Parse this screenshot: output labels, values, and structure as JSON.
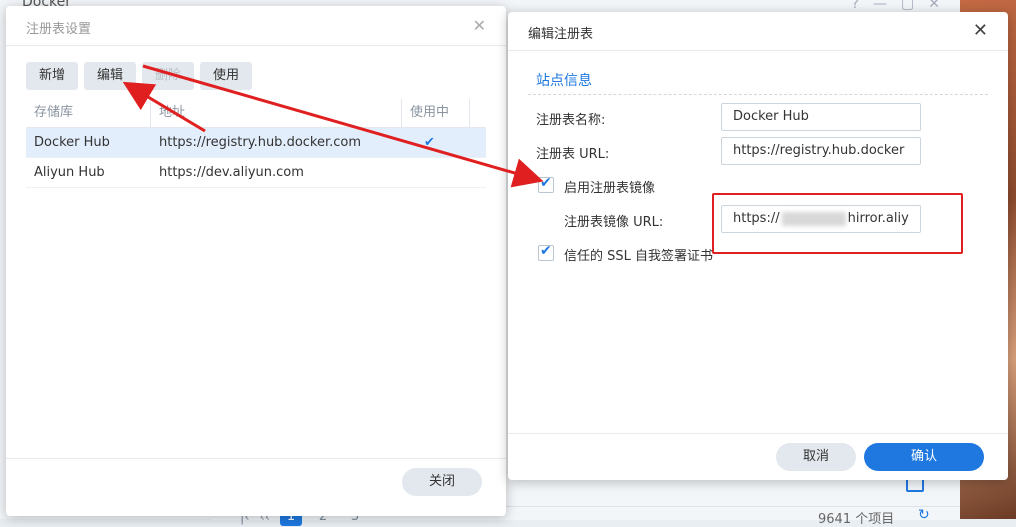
{
  "background": {
    "app_title": "Docker",
    "pager": {
      "pages": [
        "1",
        "2",
        "3"
      ],
      "active": "1"
    },
    "item_count": "9641 个项目"
  },
  "registry_settings": {
    "title": "注册表设置",
    "toolbar": {
      "add": "新增",
      "edit": "编辑",
      "delete": "删除",
      "use": "使用"
    },
    "columns": [
      "存储库",
      "地址",
      "使用中"
    ],
    "rows": [
      {
        "name": "Docker Hub",
        "url": "https://registry.hub.docker.com",
        "in_use": true
      },
      {
        "name": "Aliyun Hub",
        "url": "https://dev.aliyun.com",
        "in_use": false
      }
    ],
    "close_label": "关闭"
  },
  "edit_registry": {
    "title": "编辑注册表",
    "section": "站点信息",
    "name_label": "注册表名称:",
    "name_value": "Docker Hub",
    "url_label": "注册表 URL:",
    "url_value": "https://registry.hub.docker",
    "mirror_enable_label": "启用注册表镜像",
    "mirror_url_label": "注册表镜像 URL:",
    "mirror_url_prefix": "https://",
    "mirror_url_suffix": "hirror.aliy",
    "ssl_label": "信任的 SSL 自我签署证书",
    "cancel": "取消",
    "ok": "确认"
  },
  "colors": {
    "accent": "#1e78e0",
    "annotation": "#e02020"
  }
}
